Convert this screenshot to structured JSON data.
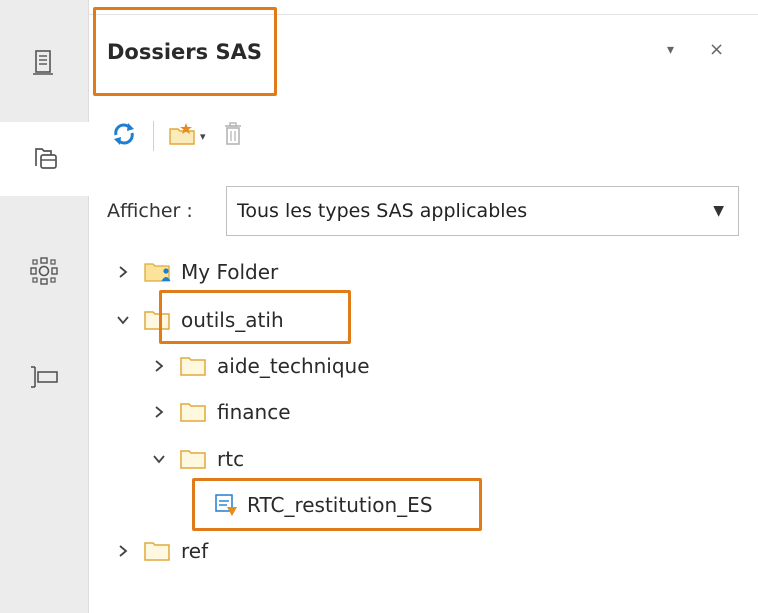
{
  "rail": {
    "items": [
      {
        "icon": "server-icon",
        "active": false
      },
      {
        "icon": "folders-icon",
        "active": true
      },
      {
        "icon": "network-icon",
        "active": false
      },
      {
        "icon": "properties-icon",
        "active": false
      }
    ]
  },
  "panel": {
    "title": "Dossiers SAS",
    "menu_glyph": "▾",
    "close_glyph": "×"
  },
  "toolbar": {
    "refresh_icon": "refresh-icon",
    "new_icon": "new-item-icon",
    "dropdown_glyph": "▾",
    "delete_icon": "delete-icon"
  },
  "filter": {
    "label": "Afficher :",
    "value": "Tous les types SAS applicables",
    "arrow": "▼"
  },
  "tree": [
    {
      "label": "My Folder",
      "expanded": false,
      "icon": "user-folder-icon"
    },
    {
      "label": "outils_atih",
      "expanded": true,
      "icon": "folder-icon"
    },
    {
      "label": "aide_technique",
      "expanded": false,
      "icon": "folder-icon"
    },
    {
      "label": "finance",
      "expanded": false,
      "icon": "folder-icon"
    },
    {
      "label": "rtc",
      "expanded": true,
      "icon": "folder-icon"
    },
    {
      "label": "RTC_restitution_ES",
      "icon": "report-icon"
    },
    {
      "label": "ref",
      "expanded": false,
      "icon": "folder-icon"
    }
  ],
  "colors": {
    "highlight": "#e07b1a",
    "folder": "#e8b84a",
    "accent": "#1e7fd0"
  }
}
